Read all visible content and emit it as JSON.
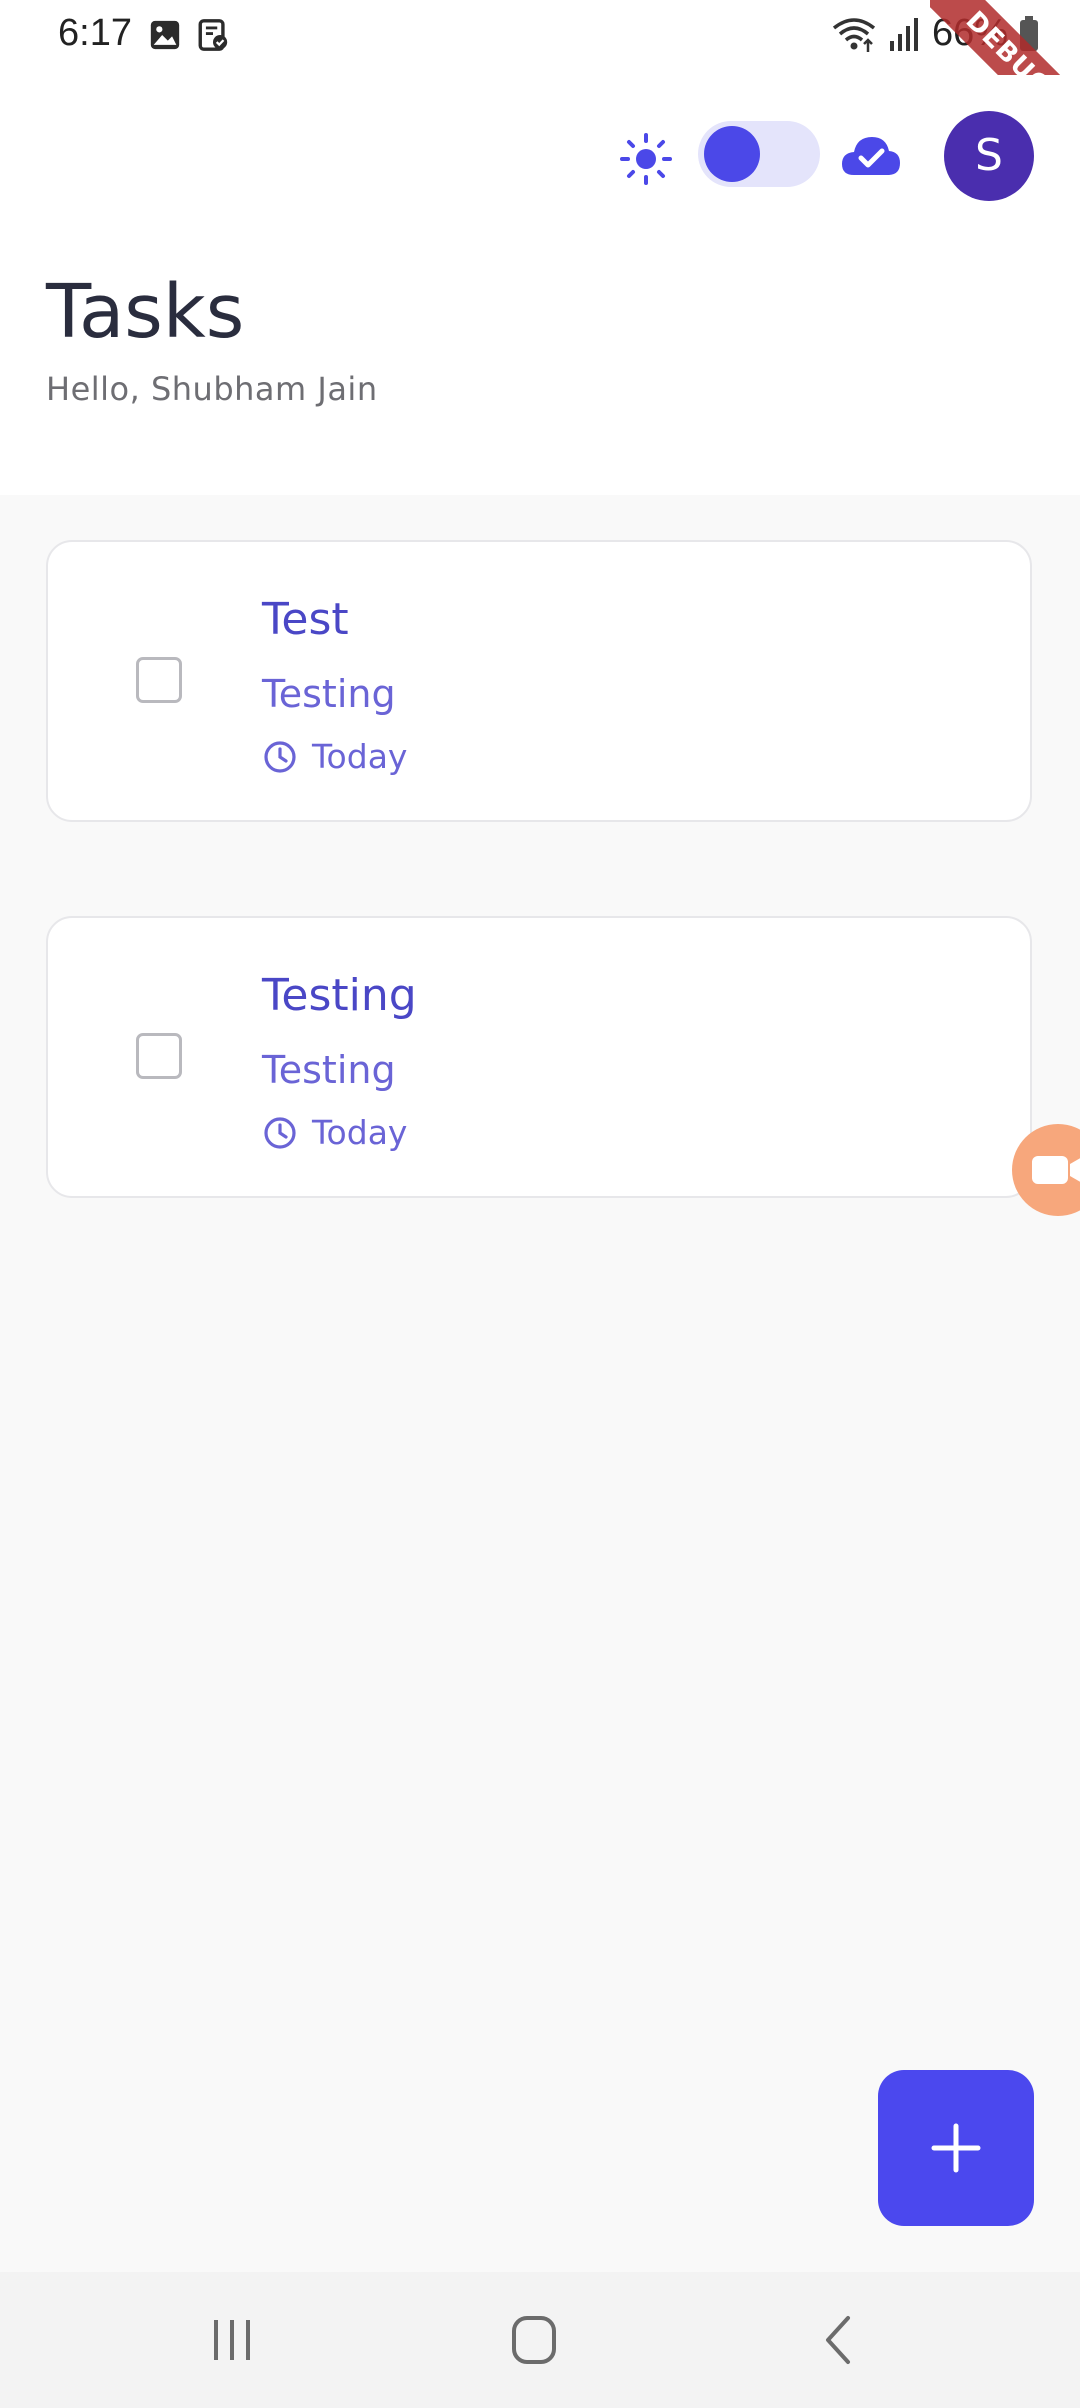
{
  "status_bar": {
    "time": "6:17",
    "battery_percent": "66%",
    "notification_icons": [
      "image-icon",
      "clipboard-check-icon"
    ],
    "system_icons": [
      "wifi-icon",
      "signal-icon",
      "battery-icon"
    ]
  },
  "debug_banner": "DEBUG",
  "header": {
    "theme_icon": "sun-icon",
    "theme_toggle_on": false,
    "sync_icon": "cloud-check-icon",
    "avatar_initial": "S",
    "title": "Tasks",
    "greeting": "Hello, Shubham Jain"
  },
  "tasks": [
    {
      "title": "Test",
      "description": "Testing",
      "due": "Today",
      "completed": false
    },
    {
      "title": "Testing",
      "description": "Testing",
      "due": "Today",
      "completed": false
    }
  ],
  "fab": {
    "icon": "plus-icon"
  },
  "navigation": {
    "buttons": [
      "recent-apps-icon",
      "home-icon",
      "back-icon"
    ]
  },
  "colors": {
    "accent": "#4b48ee",
    "avatar": "#4a2eae",
    "task_text": "#4a47c6",
    "title_text": "#2a2d3e",
    "background": "#f9f9f9"
  }
}
